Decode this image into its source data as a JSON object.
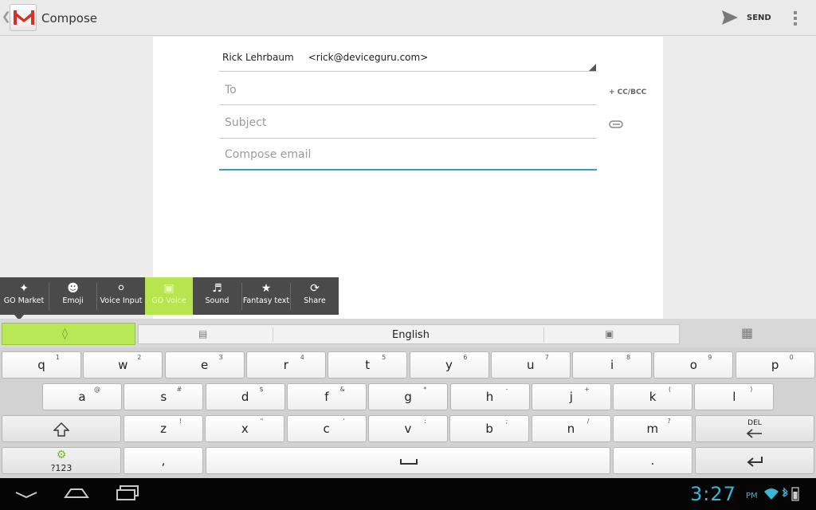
{
  "actionbar": {
    "title": "Compose",
    "send_label": "SEND",
    "icon": "gmail-logo-icon"
  },
  "compose": {
    "from_name": "Rick Lehrbaum",
    "from_email": "<rick@deviceguru.com>",
    "to_placeholder": "To",
    "subject_placeholder": "Subject",
    "body_placeholder": "Compose email",
    "cc_bcc_label": "+ CC/BCC"
  },
  "popup": {
    "items": [
      {
        "label": "GO Market",
        "icon": "puzzle-icon"
      },
      {
        "label": "Emoji",
        "icon": "smiley-icon"
      },
      {
        "label": "Voice Input",
        "icon": "microphone-icon"
      },
      {
        "label": "GO Voice",
        "icon": "go-voice-icon"
      },
      {
        "label": "Sound",
        "icon": "speaker-icon"
      },
      {
        "label": "Fantasy text",
        "icon": "fantasy-text-icon"
      },
      {
        "label": "Share",
        "icon": "share-icon"
      }
    ],
    "active_index": 3,
    "active_color": "#b8e44f"
  },
  "keyboard": {
    "language": "English",
    "row1": [
      {
        "k": "q",
        "s": "1"
      },
      {
        "k": "w",
        "s": "2"
      },
      {
        "k": "e",
        "s": "3"
      },
      {
        "k": "r",
        "s": "4"
      },
      {
        "k": "t",
        "s": "5"
      },
      {
        "k": "y",
        "s": "6"
      },
      {
        "k": "u",
        "s": "7"
      },
      {
        "k": "i",
        "s": "8"
      },
      {
        "k": "o",
        "s": "9"
      },
      {
        "k": "p",
        "s": "0"
      }
    ],
    "row2": [
      {
        "k": "a",
        "s": "@"
      },
      {
        "k": "s",
        "s": "#"
      },
      {
        "k": "d",
        "s": "$"
      },
      {
        "k": "f",
        "s": "&"
      },
      {
        "k": "g",
        "s": "*"
      },
      {
        "k": "h",
        "s": "-"
      },
      {
        "k": "j",
        "s": "+"
      },
      {
        "k": "k",
        "s": "("
      },
      {
        "k": "l",
        "s": ")"
      }
    ],
    "row3": [
      {
        "k": "z",
        "s": "!"
      },
      {
        "k": "x",
        "s": "\""
      },
      {
        "k": "c",
        "s": "'"
      },
      {
        "k": "v",
        "s": ":"
      },
      {
        "k": "b",
        "s": ";"
      },
      {
        "k": "n",
        "s": "/"
      },
      {
        "k": "m",
        "s": "?"
      }
    ],
    "del_label": "DEL",
    "sym_label": "?123",
    "comma": ",",
    "period": "."
  },
  "statusbar": {
    "time": "3:27",
    "ampm": "PM"
  }
}
